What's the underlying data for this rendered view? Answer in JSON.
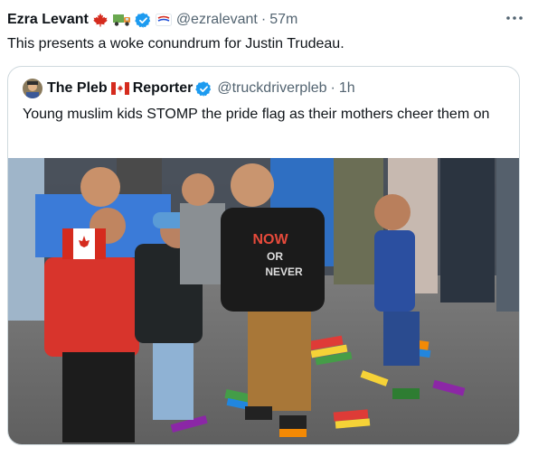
{
  "tweet": {
    "author_name": "Ezra Levant",
    "emoji_icons": [
      "canada-flag-icon",
      "truck-icon"
    ],
    "handle": "@ezralevant",
    "separator": "·",
    "time": "57m",
    "text": "This presents a woke conundrum for Justin Trudeau."
  },
  "quoted": {
    "author_name_part1": "The Pleb",
    "author_name_part2": "Reporter",
    "handle": "@truckdriverpleb",
    "separator": "·",
    "time": "1h",
    "text": "Young muslim kids STOMP the pride flag as their mothers cheer them on"
  },
  "media": {
    "shirt_text_lines": [
      "NOW",
      "OR",
      "NEVER"
    ]
  },
  "colors": {
    "verified": "#1d9bf0",
    "secondary_text": "#536471",
    "border": "#cfd9de",
    "canada_red": "#d52b1e"
  }
}
